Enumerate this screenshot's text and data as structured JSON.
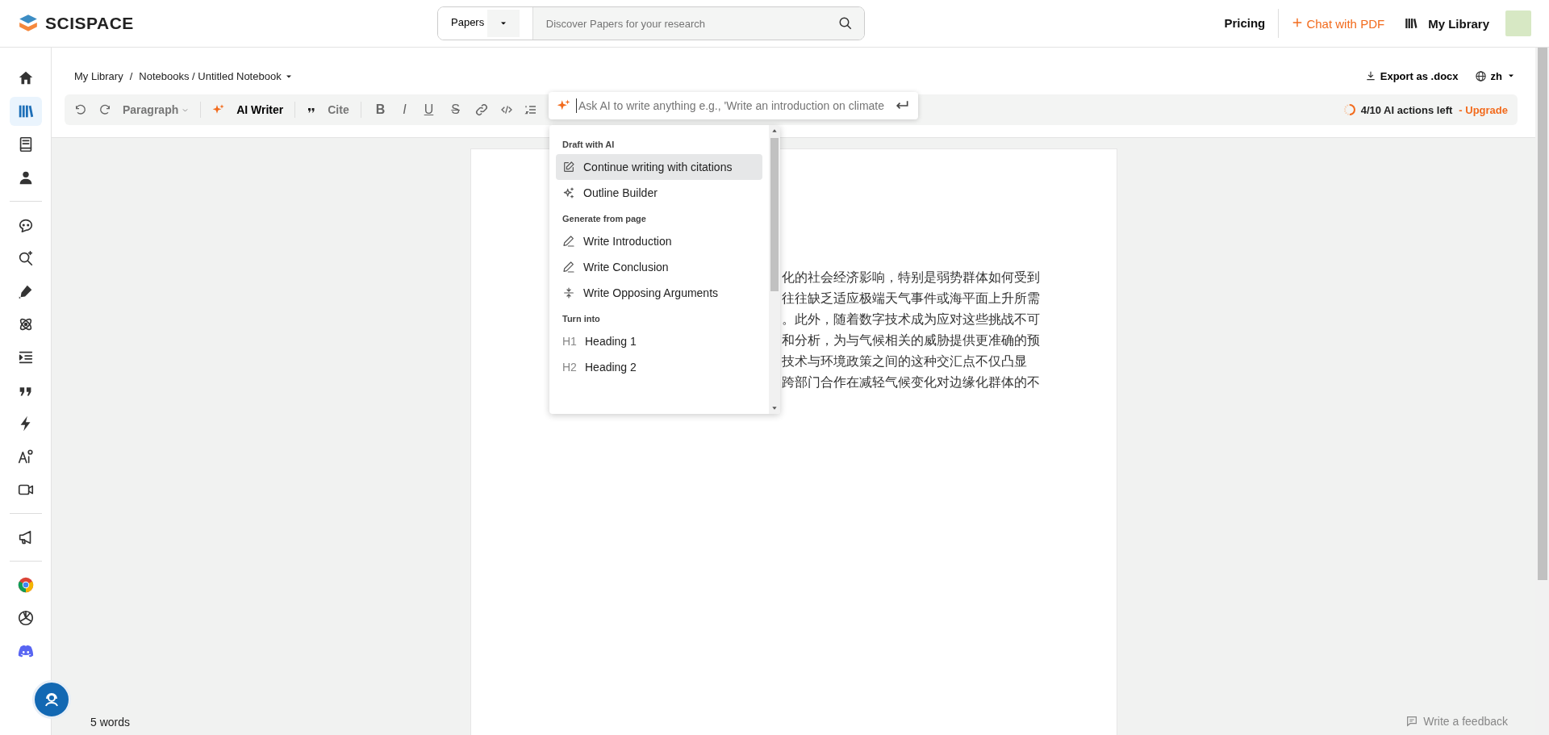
{
  "header": {
    "logo": "SCISPACE",
    "search": {
      "scope": "Papers",
      "placeholder": "Discover Papers for your research"
    },
    "nav": [
      {
        "label": "Pricing",
        "kind": "plain"
      },
      {
        "label": "Chat with PDF",
        "kind": "accent"
      },
      {
        "label": "My Library",
        "kind": "library"
      }
    ]
  },
  "sidebar": {
    "groups": [
      [
        {
          "kind": "home",
          "selected": false
        },
        {
          "kind": "library",
          "selected": true
        },
        {
          "kind": "book",
          "selected": false
        },
        {
          "kind": "person",
          "selected": false
        }
      ],
      [
        {
          "kind": "chat",
          "selected": false
        },
        {
          "kind": "search",
          "selected": false
        },
        {
          "kind": "pen",
          "selected": false
        },
        {
          "kind": "atom",
          "selected": false
        },
        {
          "kind": "indent",
          "selected": false
        },
        {
          "kind": "quote",
          "selected": false
        },
        {
          "kind": "bolt",
          "selected": false
        },
        {
          "kind": "ai",
          "selected": false
        },
        {
          "kind": "video",
          "selected": false
        }
      ],
      [
        {
          "kind": "megaphone",
          "selected": false
        }
      ],
      [
        {
          "kind": "chrome",
          "selected": false
        },
        {
          "kind": "knot",
          "selected": false
        },
        {
          "kind": "discord",
          "selected": false
        }
      ]
    ]
  },
  "breadcrumb": [
    "My Library",
    "/",
    "Notebooks / Untitled Notebook"
  ],
  "export": "Export as .docx",
  "language": "zh",
  "toolbar": {
    "style": "Paragraph",
    "ai_writer": "AI Writer",
    "cite": "Cite",
    "format": [
      "B",
      "I",
      "U",
      "S"
    ],
    "quota": "4/10 AI actions left",
    "upgrade": "- Upgrade"
  },
  "ask_ai": {
    "placeholder": "Ask AI to write anything e.g., 'Write an introduction on climate"
  },
  "menu": [
    {
      "title": "Draft with AI",
      "items": [
        {
          "label": "Continue writing with citations",
          "kind": "edit",
          "selected": true
        },
        {
          "label": "Outline Builder",
          "kind": "sparkle",
          "selected": false
        }
      ]
    },
    {
      "title": "Generate from page",
      "items": [
        {
          "label": "Write Introduction",
          "kind": "pencil",
          "selected": false
        },
        {
          "label": "Write Conclusion",
          "kind": "pencil",
          "selected": false
        },
        {
          "label": "Write Opposing Arguments",
          "kind": "split",
          "selected": false
        }
      ]
    },
    {
      "title": "Turn into",
      "items": [
        {
          "label": "Heading 1",
          "kind": "heading",
          "marker": "H1",
          "selected": false
        },
        {
          "label": "Heading 2",
          "kind": "heading",
          "marker": "H2",
          "selected": false
        }
      ]
    }
  ],
  "document": {
    "lines": [
      "化的社会经济影响，特别是弱势群体如何受到",
      "往往缺乏适应极端天气事件或海平面上升所需",
      "。此外，随着数字技术成为应对这些挑战不可",
      "和分析，为与气候相关的威胁提供更准确的预",
      "技术与环境政策之间的这种交汇点不仅凸显",
      "跨部门合作在减轻气候变化对边缘化群体的不"
    ]
  },
  "footer": {
    "word_count": "5 words",
    "feedback": "Write a feedback"
  }
}
